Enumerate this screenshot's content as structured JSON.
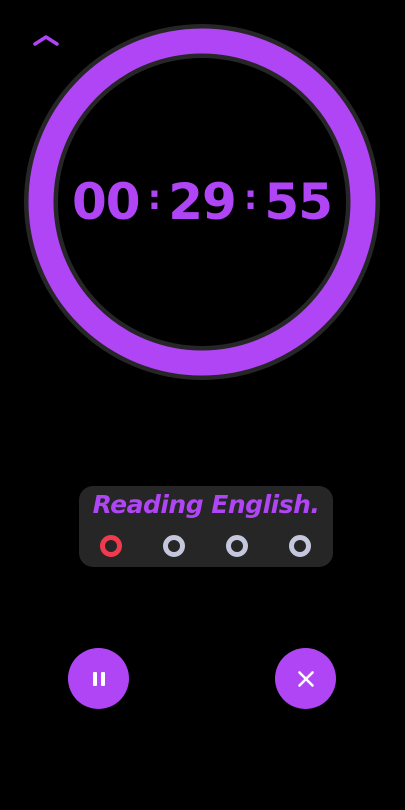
{
  "colors": {
    "accent": "#b045f5",
    "ring_track": "#262626",
    "card_background": "#262626",
    "dot_active": "#f23a4e",
    "dot_inactive": "#c5c7dc",
    "background": "#000000",
    "icon": "#ffffff"
  },
  "timer": {
    "hours": "00",
    "minutes": "29",
    "seconds": "55",
    "separator": ":",
    "ring_progress": 1.0
  },
  "task": {
    "title": "Reading English.",
    "sessions": [
      {
        "state": "active"
      },
      {
        "state": "inactive"
      },
      {
        "state": "inactive"
      },
      {
        "state": "inactive"
      }
    ]
  },
  "controls": {
    "collapse_icon": "chevron-up-icon",
    "pause_icon": "pause-icon",
    "stop_icon": "close-icon"
  }
}
